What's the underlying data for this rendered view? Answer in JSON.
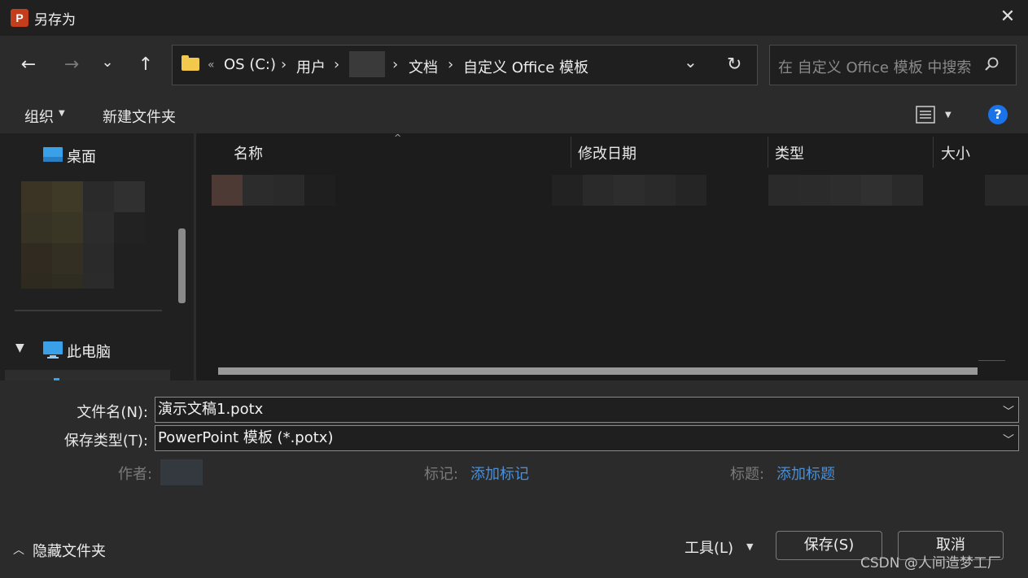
{
  "window": {
    "title": "另存为",
    "app_icon_letter": "P"
  },
  "nav": {
    "back": "←",
    "forward": "→",
    "recent": "⌄",
    "up": "↑",
    "breadcrumb": {
      "overflow": "«",
      "drive": "OS (C:)",
      "users": "用户",
      "sep": "›",
      "documents": "文档",
      "folder": "自定义 Office 模板"
    },
    "dropdown": "⌄",
    "refresh": "↻"
  },
  "search": {
    "placeholder": "在 自定义 Office 模板 中搜索"
  },
  "toolbar": {
    "organize": "组织",
    "new_folder": "新建文件夹"
  },
  "sidebar": {
    "desktop": "桌面",
    "this_pc": "此电脑"
  },
  "columns": {
    "name": "名称",
    "modified": "修改日期",
    "type": "类型",
    "size": "大小"
  },
  "form": {
    "filename_label": "文件名(N):",
    "filename_value": "演示文稿1.potx",
    "filetype_label": "保存类型(T):",
    "filetype_value": "PowerPoint 模板 (*.potx)",
    "author_label": "作者:",
    "tags_label": "标记:",
    "tags_link": "添加标记",
    "title_label": "标题:",
    "title_link": "添加标题"
  },
  "footer": {
    "hide_folders": "隐藏文件夹",
    "tools": "工具(L)",
    "save": "保存(S)",
    "cancel": "取消"
  },
  "watermark": "CSDN @人间造梦工厂",
  "colors": {
    "dark_bg": "#202020",
    "panel": "#2b2b2b",
    "accent": "#1a73e8",
    "link": "#4a90d9",
    "ppt": "#c43e1c"
  }
}
